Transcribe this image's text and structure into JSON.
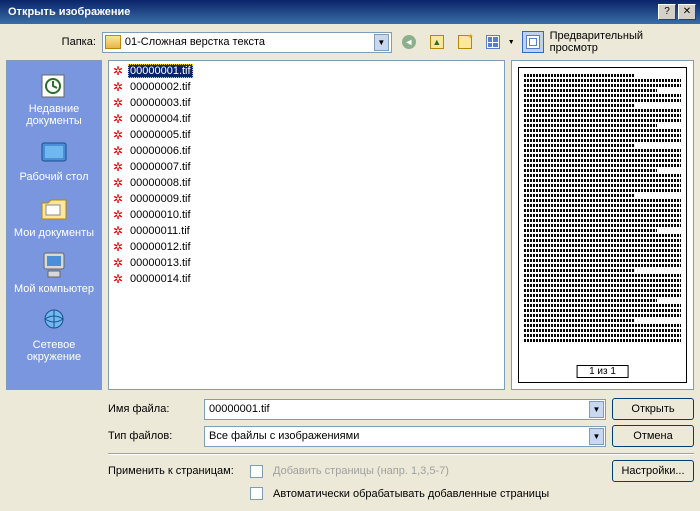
{
  "title": "Открыть изображение",
  "toprow": {
    "label": "Папка:",
    "folder": "01-Сложная верстка текста",
    "preview_btn": "Предварительный просмотр"
  },
  "places": [
    {
      "label": "Недавние документы",
      "icon": "recent"
    },
    {
      "label": "Рабочий стол",
      "icon": "desktop"
    },
    {
      "label": "Мои документы",
      "icon": "mydocs"
    },
    {
      "label": "Мой компьютер",
      "icon": "mycomputer"
    },
    {
      "label": "Сетевое окружение",
      "icon": "network"
    }
  ],
  "files": [
    {
      "name": "00000001.tif",
      "selected": true
    },
    {
      "name": "00000002.tif"
    },
    {
      "name": "00000003.tif"
    },
    {
      "name": "00000004.tif"
    },
    {
      "name": "00000005.tif"
    },
    {
      "name": "00000006.tif"
    },
    {
      "name": "00000007.tif"
    },
    {
      "name": "00000008.tif"
    },
    {
      "name": "00000009.tif"
    },
    {
      "name": "00000010.tif"
    },
    {
      "name": "00000011.tif"
    },
    {
      "name": "00000012.tif"
    },
    {
      "name": "00000013.tif"
    },
    {
      "name": "00000014.tif"
    }
  ],
  "preview": {
    "pager": "1 из 1"
  },
  "bottom": {
    "filename_label": "Имя файла:",
    "filename_value": "00000001.tif",
    "filetype_label": "Тип файлов:",
    "filetype_value": "Все файлы с изображениями",
    "apply_label": "Применить к страницам:",
    "add_pages_label": "Добавить страницы (напр. 1,3,5-7)",
    "auto_label": "Автоматически обрабатывать добавленные страницы"
  },
  "buttons": {
    "open": "Открыть",
    "cancel": "Отмена",
    "settings": "Настройки..."
  }
}
